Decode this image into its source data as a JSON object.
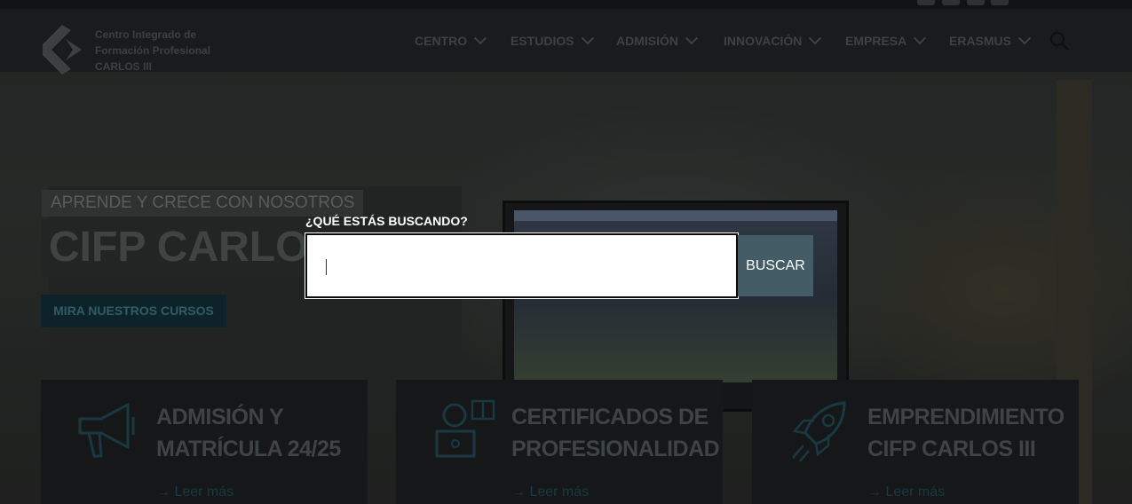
{
  "header": {
    "logo_lines": [
      "Centro Integrado de",
      "Formación Profesional",
      "CARLOS III"
    ],
    "nav": [
      {
        "label": "CENTRO"
      },
      {
        "label": "ESTUDIOS"
      },
      {
        "label": "ADMISIÓN"
      },
      {
        "label": "INNOVACIÓN"
      },
      {
        "label": "EMPRESA"
      },
      {
        "label": "ERASMUS"
      }
    ],
    "search_icon": "search-icon",
    "social_icons": [
      "facebook-icon",
      "twitter-icon",
      "instagram-icon",
      "youtube-icon"
    ]
  },
  "hero": {
    "subtitle": "APRENDE Y CRECE CON NOSOTROS",
    "title": "CIFP CARLOS III",
    "cta": "MIRA NUESTROS CURSOS"
  },
  "cards": [
    {
      "title_lines": [
        "ADMISIÓN Y",
        "MATRÍCULA 24/25"
      ],
      "more": "→ Leer más",
      "icon": "megaphone-icon"
    },
    {
      "title_lines": [
        "CERTIFICADOS DE",
        "PROFESIONALIDAD"
      ],
      "more": "→ Leer más",
      "icon": "student-laptop-icon"
    },
    {
      "title_lines": [
        "EMPRENDIMIENTO",
        "CIFP CARLOS III"
      ],
      "more": "→ Leer más",
      "icon": "rocket-icon"
    }
  ],
  "search_overlay": {
    "label": "¿QUÉ ESTÁS BUSCANDO?",
    "input_value": "",
    "button_label": "BUSCAR"
  },
  "colors": {
    "accent": "#435c65",
    "cta_bg": "#102a33",
    "cta_text": "#3c6f7c"
  }
}
